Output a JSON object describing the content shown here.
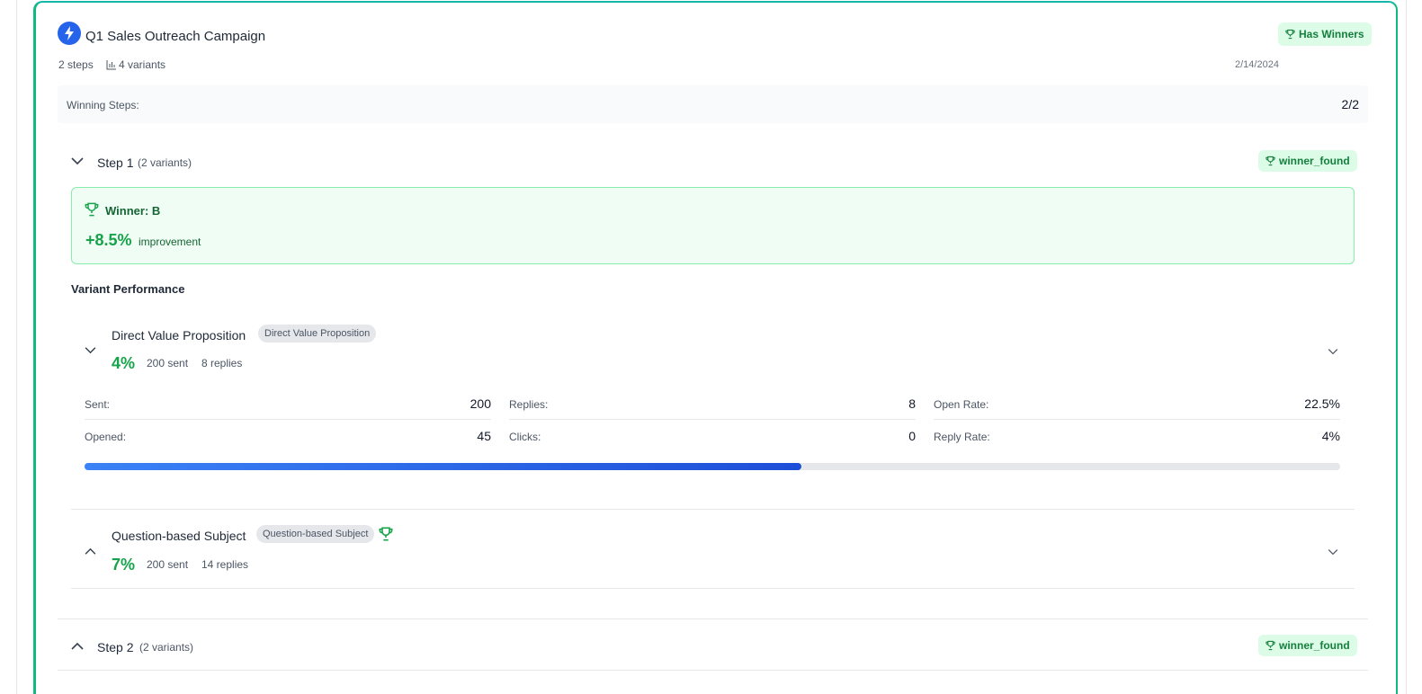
{
  "campaign": {
    "title": "Q1 Sales Outreach Campaign",
    "steps": "2 steps",
    "variants": "4 variants",
    "badge": "Has Winners",
    "date": "2/14/2024",
    "winning_steps_label": "Winning Steps:",
    "winning_steps_value": "2/2"
  },
  "steps": [
    {
      "title": "Step 1",
      "sub": "(2 variants)",
      "status": "winner_found",
      "winner": {
        "title": "Winner: B",
        "improvement": "+8.5%",
        "improvement_label": "improvement"
      },
      "section_title": "Variant Performance",
      "variants": [
        {
          "name": "Direct Value Proposition",
          "tag": "Direct Value Proposition",
          "rate": "4%",
          "sent": "200 sent",
          "replies": "8 replies",
          "stats": {
            "sent_label": "Sent:",
            "sent": "200",
            "replies_label": "Replies:",
            "replies": "8",
            "open_rate_label": "Open Rate:",
            "open_rate": "22.5%",
            "opened_label": "Opened:",
            "opened": "45",
            "clicks_label": "Clicks:",
            "clicks": "0",
            "reply_rate_label": "Reply Rate:",
            "reply_rate": "4%"
          },
          "progress": 0.571
        },
        {
          "name": "Question-based Subject",
          "tag": "Question-based Subject",
          "rate": "7%",
          "sent": "200 sent",
          "replies": "14 replies"
        }
      ]
    },
    {
      "title": "Step 2",
      "sub": "(2 variants)",
      "status": "winner_found"
    }
  ],
  "colors": {
    "accent": "#10b981",
    "winner_text": "#16a34a",
    "progress": "#2563eb"
  }
}
